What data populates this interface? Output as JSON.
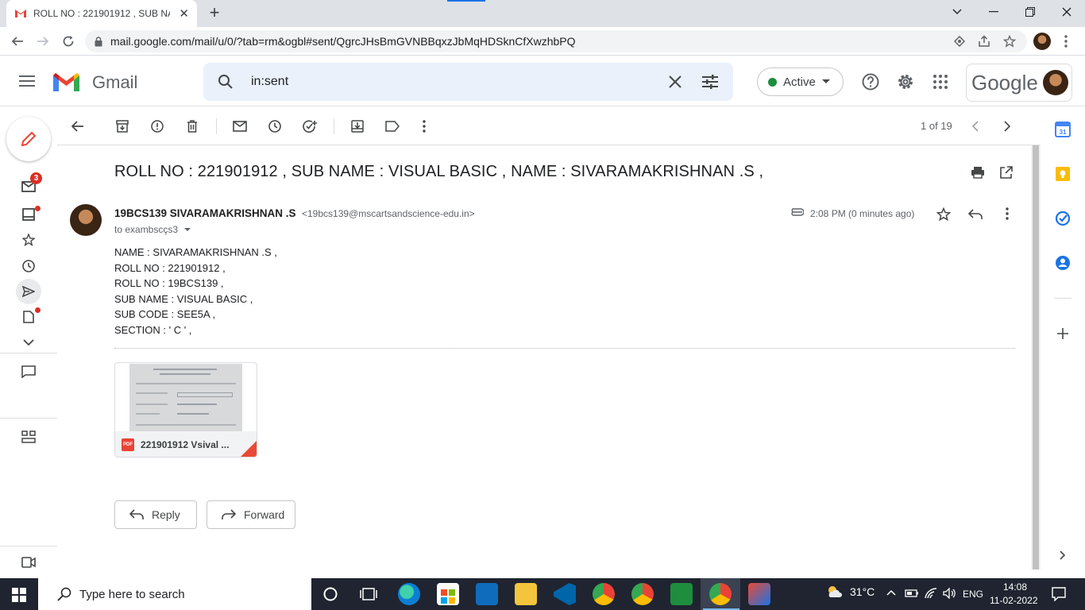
{
  "browser": {
    "tab_title": "ROLL NO : 221901912 , SUB NAM",
    "tab_close": "✕",
    "new_tab": "+",
    "url": "mail.google.com/mail/u/0/?tab=rm&ogbl#sent/QgrcJHsBmGVNBBqxzJbMqHDSknCfXwzhbPQ"
  },
  "gmail": {
    "brand": "Gmail",
    "search_value": "in:sent",
    "status_label": "Active",
    "account_brand": "Google",
    "mail_badge": "3"
  },
  "toolbar": {
    "pager": "1 of 19"
  },
  "message": {
    "subject": "ROLL NO : 221901912 , SUB NAME : VISUAL BASIC , NAME : SIVARAMAKRISHNAN .S ,",
    "sender_name": "19BCS139 SIVARAMAKRISHNAN .S",
    "sender_email": "<19bcs139@mscartsandscience-edu.in>",
    "recipient": "to exambscçs3",
    "time": "2:08 PM (0 minutes ago)",
    "body": [
      "NAME : SIVARAMAKRISHNAN .S ,",
      "ROLL NO : 221901912 ,",
      "ROLL NO : 19BCS139 ,",
      "SUB NAME : VISUAL BASIC ,",
      "SUB CODE : SEE5A ,",
      "SECTION : ' C ' ,"
    ],
    "attachment": {
      "name": "221901912 Vsival ...",
      "type_label": "PDF"
    },
    "reply_label": "Reply",
    "forward_label": "Forward"
  },
  "taskbar": {
    "search_placeholder": "Type here to search",
    "temperature": "31°C",
    "language": "ENG",
    "time": "14:08",
    "date": "11-02-2022"
  }
}
